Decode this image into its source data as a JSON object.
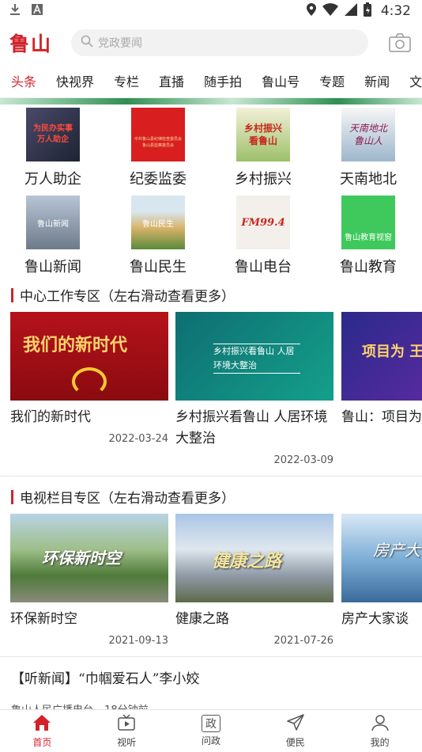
{
  "status_bar": {
    "time": "4:32"
  },
  "header": {
    "logo": "鲁山",
    "search_placeholder": "党政要闻"
  },
  "tabs": [
    {
      "label": "头条",
      "active": true
    },
    {
      "label": "快视界"
    },
    {
      "label": "专栏"
    },
    {
      "label": "直播"
    },
    {
      "label": "随手拍"
    },
    {
      "label": "鲁山号"
    },
    {
      "label": "专题"
    },
    {
      "label": "新闻"
    },
    {
      "label": "文"
    }
  ],
  "grid": [
    {
      "label": "万人助企",
      "thumb_text": "为民办实事 万人助企"
    },
    {
      "label": "纪委监委",
      "thumb_text": "中共鲁山县纪律检查委员会 鲁山县监察委员会"
    },
    {
      "label": "乡村振兴",
      "thumb_text": "乡村振兴 看鲁山"
    },
    {
      "label": "天南地北",
      "thumb_text": "天南地北 鲁山人"
    },
    {
      "label": "鲁山新闻",
      "thumb_text": "鲁山新闻"
    },
    {
      "label": "鲁山民生",
      "thumb_text": "鲁山民生"
    },
    {
      "label": "鲁山电台",
      "thumb_text": "FM99.4"
    },
    {
      "label": "鲁山教育",
      "thumb_text": "鲁山教育视窗"
    }
  ],
  "section1": {
    "title": "中心工作专区（左右滑动查看更多）",
    "cards": [
      {
        "title": "我们的新时代",
        "date": "2022-03-24",
        "img_text": "我们的新时代"
      },
      {
        "title": "乡村振兴看鲁山 人居环境大整治",
        "date": "2022-03-09",
        "img_text": "乡村振兴看鲁山 人居环境大整治"
      },
      {
        "title": "鲁山：项目为",
        "date": "",
        "img_text": "项目为 王 产"
      }
    ]
  },
  "section2": {
    "title": "电视栏目专区（左右滑动查看更多）",
    "cards": [
      {
        "title": "环保新时空",
        "date": "2021-09-13",
        "img_text": "环保新时空"
      },
      {
        "title": "健康之路",
        "date": "2021-07-26",
        "img_text": "健康之路"
      },
      {
        "title": "房产大家谈",
        "date": "",
        "img_text": "房产大"
      }
    ]
  },
  "news": {
    "title": "【听新闻】“巾帼爱石人”李小姣",
    "source": "鲁山人民广播电台",
    "time": "18分钟前"
  },
  "bottom_nav": [
    {
      "label": "首页",
      "icon": "home-icon",
      "active": true
    },
    {
      "label": "视听",
      "icon": "tv-icon"
    },
    {
      "label": "问政",
      "icon": "zheng-icon",
      "glyph": "政"
    },
    {
      "label": "便民",
      "icon": "send-icon"
    },
    {
      "label": "我的",
      "icon": "user-icon"
    }
  ]
}
